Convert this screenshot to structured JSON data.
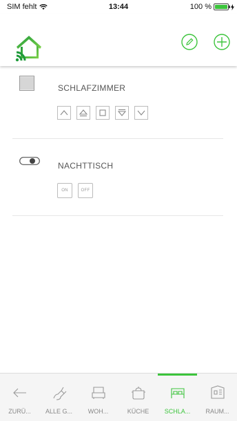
{
  "status": {
    "carrier": "SIM fehlt",
    "time": "13:44",
    "battery": "100 %",
    "battery_level": 1.0
  },
  "header": {
    "logo_icon": "home-wifi-logo",
    "edit_icon": "pencil-icon",
    "add_icon": "plus-icon",
    "accent": "#3cc43c"
  },
  "devices": [
    {
      "name": "SCHLAFZIMMER",
      "icon": "blinds-icon",
      "controls": [
        "arrow-up",
        "arrow-up-stop",
        "stop",
        "arrow-down-stop",
        "arrow-down"
      ]
    },
    {
      "name": "NACHTTISCH",
      "icon": "toggle-switch-icon",
      "controls": [
        "ON",
        "OFF"
      ]
    }
  ],
  "tabs": [
    {
      "label": "ZURÜ...",
      "icon": "arrow-left-icon",
      "active": false
    },
    {
      "label": "ALLE G...",
      "icon": "plug-icon",
      "active": false
    },
    {
      "label": "WOH...",
      "icon": "armchair-icon",
      "active": false
    },
    {
      "label": "KÜCHE",
      "icon": "pot-icon",
      "active": false
    },
    {
      "label": "SCHLA...",
      "icon": "bed-icon",
      "active": true
    },
    {
      "label": "RAUM...",
      "icon": "room-icon",
      "active": false
    }
  ]
}
